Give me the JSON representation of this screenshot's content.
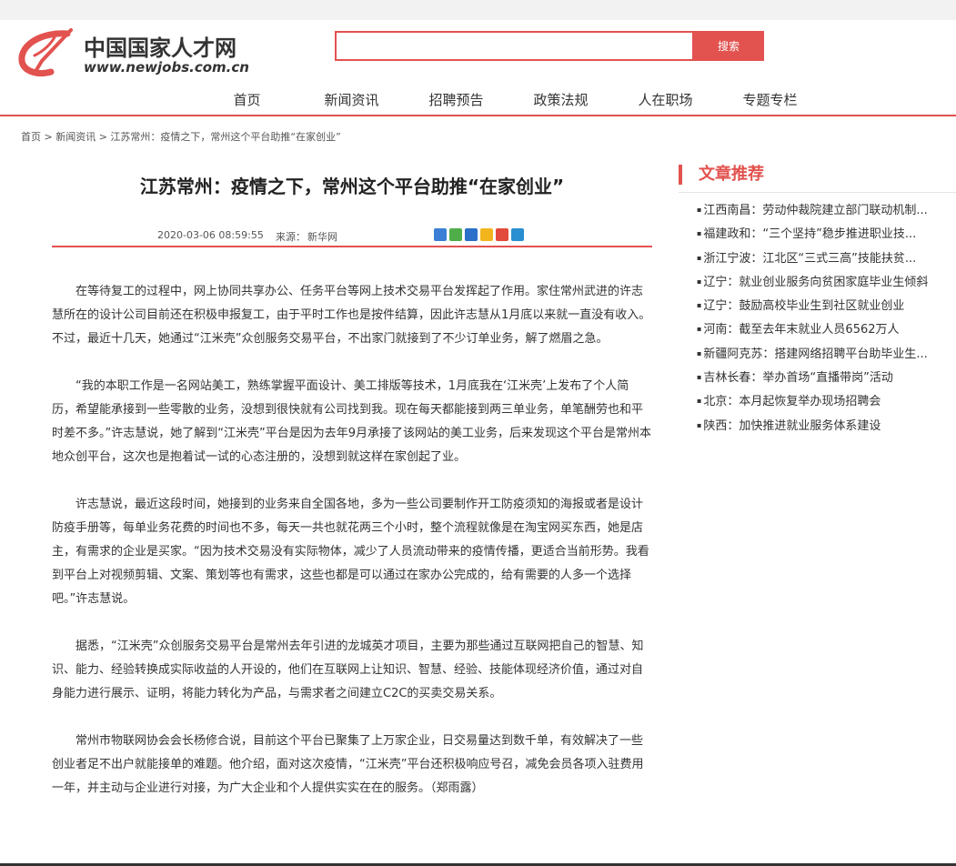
{
  "logo": {
    "title": "中国国家人才网",
    "url": "www.newjobs.com.cn"
  },
  "search": {
    "value": "",
    "button_label": "搜索"
  },
  "nav": {
    "items": [
      {
        "label": "首页"
      },
      {
        "label": "新闻资讯"
      },
      {
        "label": "招聘预告"
      },
      {
        "label": "政策法规"
      },
      {
        "label": "人在职场"
      },
      {
        "label": "专题专栏"
      }
    ]
  },
  "breadcrumb": {
    "text": "首页 > 新闻资讯 > 江苏常州：疫情之下，常州这个平台助推“在家创业”"
  },
  "article": {
    "title": "江苏常州：疫情之下，常州这个平台助推“在家创业”",
    "date": "2020-03-06 08:59:55",
    "source_label": "来源：",
    "source": "新华网",
    "paragraphs": [
      "在等待复工的过程中，网上协同共享办公、任务平台等网上技术交易平台发挥起了作用。家住常州武进的许志慧所在的设计公司目前还在积极申报复工，由于平时工作也是按件结算，因此许志慧从1月底以来就一直没有收入。不过，最近十几天，她通过“江米壳”众创服务交易平台，不出家门就接到了不少订单业务，解了燃眉之急。",
      "“我的本职工作是一名网站美工，熟练掌握平面设计、美工排版等技术，1月底我在‘江米壳’上发布了个人简历，希望能承接到一些零散的业务，没想到很快就有公司找到我。现在每天都能接到两三单业务，单笔酬劳也和平时差不多。”许志慧说，她了解到“江米壳”平台是因为去年9月承接了该网站的美工业务，后来发现这个平台是常州本地众创平台，这次也是抱着试一试的心态注册的，没想到就这样在家创起了业。",
      "许志慧说，最近这段时间，她接到的业务来自全国各地，多为一些公司要制作开工防疫须知的海报或者是设计防疫手册等，每单业务花费的时间也不多，每天一共也就花两三个小时，整个流程就像是在淘宝网买东西，她是店主，有需求的企业是买家。“因为技术交易没有实际物体，减少了人员流动带来的疫情传播，更适合当前形势。我看到平台上对视频剪辑、文案、策划等也有需求，这些也都是可以通过在家办公完成的，给有需要的人多一个选择吧。”许志慧说。",
      "据悉，“江米壳”众创服务交易平台是常州去年引进的龙城英才项目，主要为那些通过互联网把自己的智慧、知识、能力、经验转换成实际收益的人开设的，他们在互联网上让知识、智慧、经验、技能体现经济价值，通过对自身能力进行展示、证明，将能力转化为产品，与需求者之间建立C2C的买卖交易关系。",
      "常州市物联网协会会长杨修合说，目前这个平台已聚集了上万家企业，日交易量达到数千单，有效解决了一些创业者足不出户就能接单的难题。他介绍，面对这次疫情，“江米壳”平台还积极响应号召，减免会员各项入驻费用一年，并主动与企业进行对接，为广大企业和个人提供实实在在的服务。（郑雨露）"
    ]
  },
  "sidebar": {
    "title": "文章推荐",
    "items": [
      {
        "label": "江西南昌：劳动仲裁院建立部门联动机制..."
      },
      {
        "label": "福建政和：“三个坚持”稳步推进职业技..."
      },
      {
        "label": "浙江宁波：江北区“三式三高”技能扶贫..."
      },
      {
        "label": "辽宁：就业创业服务向贫困家庭毕业生倾斜"
      },
      {
        "label": "辽宁：鼓励高校毕业生到社区就业创业"
      },
      {
        "label": "河南：截至去年末就业人员6562万人"
      },
      {
        "label": "新疆阿克苏：搭建网络招聘平台助毕业生..."
      },
      {
        "label": "吉林长春：举办首场“直播带岗”活动"
      },
      {
        "label": "北京：本月起恢复举办现场招聘会"
      },
      {
        "label": "陕西：加快推进就业服务体系建设"
      }
    ]
  },
  "colors": {
    "accent": "#e2524f"
  }
}
